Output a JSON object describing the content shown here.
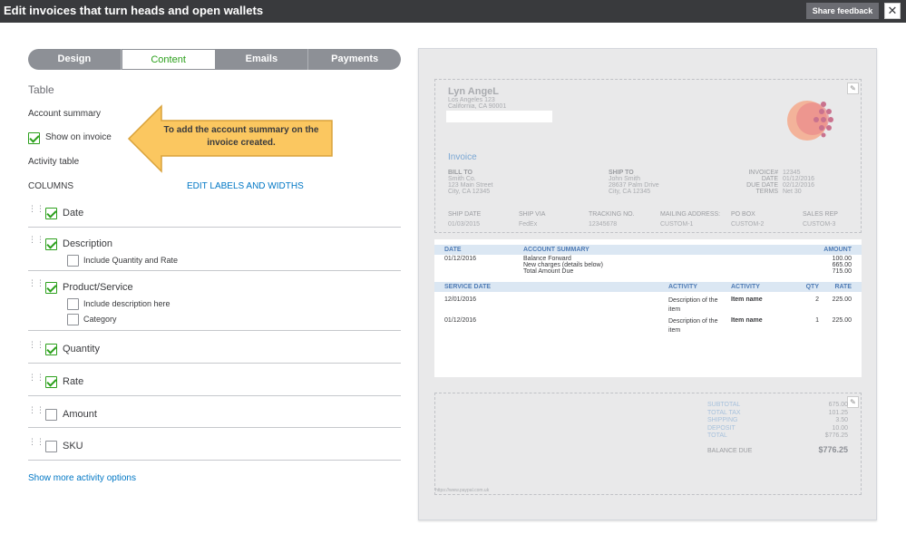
{
  "header": {
    "title": "Edit invoices that turn heads and open wallets",
    "feedback_label": "Share feedback",
    "close_label": "✕"
  },
  "tabs": [
    {
      "label": "Design"
    },
    {
      "label": "Content"
    },
    {
      "label": "Emails"
    },
    {
      "label": "Payments"
    }
  ],
  "panel": {
    "section_title": "Table",
    "account_summary": "Account summary",
    "show_on_invoice": "Show on invoice",
    "activity_table": "Activity table",
    "columns": "COLUMNS",
    "edit_labels": "EDIT LABELS AND WIDTHS",
    "show_more": "Show more activity options",
    "items": [
      {
        "label": "Date",
        "checked": true
      },
      {
        "label": "Description",
        "checked": true
      },
      {
        "label": "Include Quantity and Rate",
        "checked": false
      },
      {
        "label": "Product/Service",
        "checked": true
      },
      {
        "label": "Include description here",
        "checked": false
      },
      {
        "label": "Category",
        "checked": false
      },
      {
        "label": "Quantity",
        "checked": true
      },
      {
        "label": "Rate",
        "checked": true
      },
      {
        "label": "Amount",
        "checked": false
      },
      {
        "label": "SKU",
        "checked": false
      }
    ]
  },
  "callout": {
    "text": "To add the account summary on the invoice created.",
    "color": "#fbc760"
  },
  "preview": {
    "company": "Lyn AngeL",
    "address1": "Los Angeles 123",
    "address2": "California, CA 90001",
    "invoice_title": "Invoice",
    "bill_to_label": "BILL TO",
    "bill_to": "Smith Co.\n123 Main Street\nCity, CA 12345",
    "ship_to_label": "SHIP TO",
    "ship_to": "John Smith\n28637 Palm Drive\nCity, CA 12345",
    "meta_labels": "INVOICE#\nDATE\nDUE DATE\nTERMS",
    "meta_values": "12345\n01/12/2016\n02/12/2016\nNet 30",
    "ship_headers": [
      "SHIP DATE",
      "SHIP VIA",
      "TRACKING NO.",
      "MAILING ADDRESS:",
      "PO BOX",
      "SALES REP"
    ],
    "ship_values": [
      "01/03/2015",
      "FedEx",
      "12345678",
      "CUSTOM-1",
      "CUSTOM-2",
      "CUSTOM-3"
    ],
    "summary_headers": {
      "date": "DATE",
      "summary": "ACCOUNT SUMMARY",
      "amount": "AMOUNT"
    },
    "summary_date": "01/12/2016",
    "summary_lines": "Balance Forward\nNew charges (details below)\nTotal Amount Due",
    "summary_amounts": "100.00\n665.00\n715.00",
    "activity_headers": {
      "service_date": "SERVICE DATE",
      "activity1": "ACTIVITY",
      "activity2": "ACTIVITY",
      "qty": "QTY",
      "rate": "RATE"
    },
    "rows": [
      {
        "date": "12/01/2016",
        "desc": "Description of the\nitem",
        "name": "Item name",
        "qty": "2",
        "rate": "225.00"
      },
      {
        "date": "01/12/2016",
        "desc": "Description of the\nitem",
        "name": "Item name",
        "qty": "1",
        "rate": "225.00"
      }
    ],
    "totals_labels": "SUBTOTAL\nTOTAL TAX\nSHIPPING\nDEPOSIT\nTOTAL",
    "totals_values": "675.00\n101.25\n3.50\n10.00\n$776.25",
    "balance_due_label": "BALANCE DUE",
    "balance_due": "$776.25",
    "footer_url": "https://www.paypal.com.uk"
  }
}
